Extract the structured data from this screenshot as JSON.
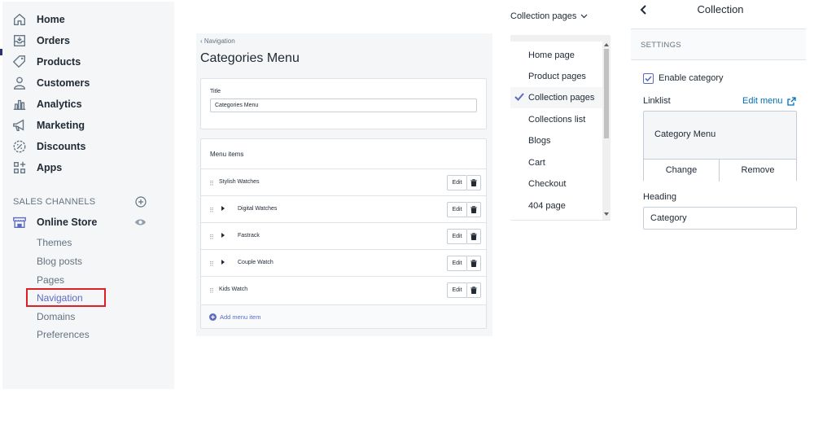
{
  "sidebar": {
    "items": [
      {
        "label": "Home",
        "icon": "home-icon"
      },
      {
        "label": "Orders",
        "icon": "orders-icon"
      },
      {
        "label": "Products",
        "icon": "tag-icon"
      },
      {
        "label": "Customers",
        "icon": "person-icon"
      },
      {
        "label": "Analytics",
        "icon": "bar-chart-icon"
      },
      {
        "label": "Marketing",
        "icon": "megaphone-icon"
      },
      {
        "label": "Discounts",
        "icon": "discount-icon"
      },
      {
        "label": "Apps",
        "icon": "apps-icon"
      }
    ],
    "sales_channels_label": "SALES CHANNELS",
    "online_store": {
      "label": "Online Store",
      "icon": "store-icon"
    },
    "sub_items": [
      "Themes",
      "Blog posts",
      "Pages",
      "Navigation",
      "Domains",
      "Preferences"
    ],
    "active_sub_item": "Navigation",
    "highlight_color": "#de1f26"
  },
  "editor": {
    "breadcrumb": "Navigation",
    "title": "Categories Menu",
    "title_field_label": "Title",
    "title_field_value": "Categories Menu",
    "menu_items_header": "Menu items",
    "menu_items": [
      {
        "label": "Stylish Watches",
        "has_children": false
      },
      {
        "label": "Digital Watches",
        "has_children": true
      },
      {
        "label": "Fastrack",
        "has_children": true
      },
      {
        "label": "Couple Watch",
        "has_children": true
      },
      {
        "label": "Kids Watch",
        "has_children": false
      }
    ],
    "edit_label": "Edit",
    "add_item_label": "Add menu item"
  },
  "dropdown": {
    "trigger_label": "Collection pages",
    "options": [
      "Home page",
      "Product pages",
      "Collection pages",
      "Collections list",
      "Blogs",
      "Cart",
      "Checkout",
      "404 page"
    ],
    "selected": "Collection pages",
    "check_color": "#5c6ac4"
  },
  "settings_panel": {
    "title": "Collection",
    "section_label": "SETTINGS",
    "checkbox_label": "Enable category",
    "checkbox_checked": true,
    "linklist_label": "Linklist",
    "edit_menu_label": "Edit menu",
    "linklist_value": "Category Menu",
    "change_label": "Change",
    "remove_label": "Remove",
    "heading_label": "Heading",
    "heading_value": "Category",
    "link_color": "#006fbb"
  }
}
